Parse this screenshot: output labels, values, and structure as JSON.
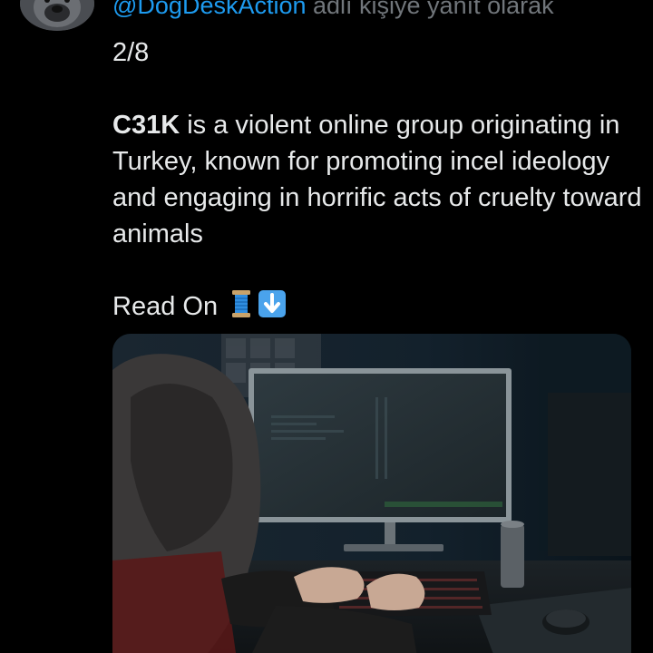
{
  "reply": {
    "mention": "@DogDeskAction",
    "suffix": " adlı kişiye yanıt olarak"
  },
  "tweet": {
    "counter": "2/8",
    "bold_name": "C31K",
    "text_rest": " is a violent online group originating in Turkey, known for promoting incel ideology and engaging in horrific acts of cruelty toward animals",
    "read_on": "Read On",
    "emoji_thread": "🧵",
    "emoji_down": "⬇️"
  },
  "colors": {
    "background": "#000000",
    "text": "#e7e9ea",
    "mention": "#1d9bf0",
    "secondary": "#71767b"
  }
}
